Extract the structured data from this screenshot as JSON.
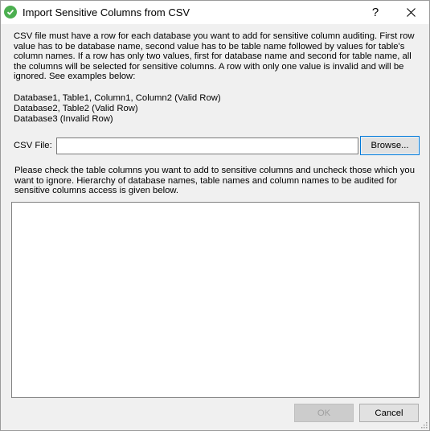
{
  "window": {
    "title": "Import Sensitive Columns from CSV",
    "help_label": "?",
    "close_label": "✕",
    "icon_color": "#4caf50"
  },
  "instructions": {
    "text": "CSV file must have a row for each database you want to add for sensitive column auditing. First row value has to be database name, second value has to be table name followed by values for table's column names. If a row has only two values, first for database name and second for table name, all the columns will be selected for sensitive columns. A row with only one value is invalid and will be ignored. See examples below:"
  },
  "examples": [
    "Database1, Table1, Column1, Column2 (Valid Row)",
    "Database2, Table2 (Valid Row)",
    "Database3 (Invalid Row)"
  ],
  "csv_file": {
    "label": "CSV File:",
    "value": "",
    "browse_label": "Browse..."
  },
  "tree": {
    "instructions": "Please check the table columns you want to add to sensitive columns and uncheck those which you want to ignore. Hierarchy of database names, table names and column names to be audited for sensitive columns access is given below."
  },
  "buttons": {
    "ok_label": "OK",
    "cancel_label": "Cancel"
  }
}
